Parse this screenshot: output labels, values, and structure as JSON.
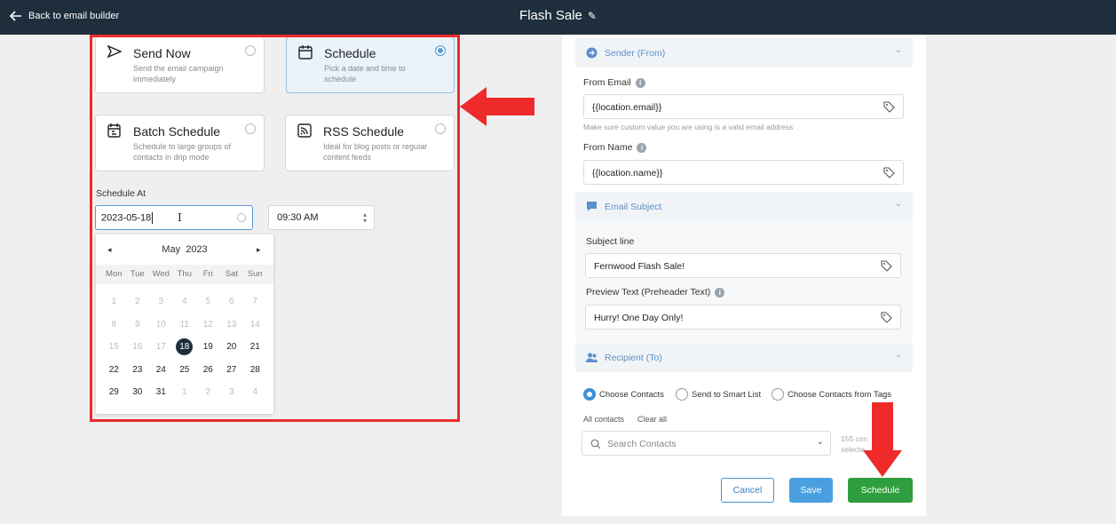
{
  "topbar": {
    "back_label": "Back to email builder",
    "title": "Flash Sale"
  },
  "options": [
    {
      "title": "Send Now",
      "desc": "Send the email campaign immediately"
    },
    {
      "title": "Schedule",
      "desc": "Pick a date and time to schedule"
    },
    {
      "title": "Batch Schedule",
      "desc": "Schedule to large groups of contacts in drip mode"
    },
    {
      "title": "RSS Schedule",
      "desc": "Ideal for blog posts or regular content feeds"
    }
  ],
  "schedule": {
    "label": "Schedule At",
    "date_value": "2023-05-18",
    "time_value": "09:30 AM",
    "calendar": {
      "month": "May",
      "year": "2023",
      "weekdays": [
        "Mon",
        "Tue",
        "Wed",
        "Thu",
        "Fri",
        "Sat",
        "Sun"
      ],
      "days": [
        [
          "1",
          "2",
          "3",
          "4",
          "5",
          "6",
          "7"
        ],
        [
          "8",
          "9",
          "10",
          "11",
          "12",
          "13",
          "14"
        ],
        [
          "15",
          "16",
          "17",
          "18",
          "19",
          "20",
          "21"
        ],
        [
          "22",
          "23",
          "24",
          "25",
          "26",
          "27",
          "28"
        ],
        [
          "29",
          "30",
          "31",
          "1",
          "2",
          "3",
          "4"
        ]
      ]
    }
  },
  "sender": {
    "title": "Sender (From)",
    "from_email_label": "From Email",
    "from_email_value": "{{location.email}}",
    "from_email_hint": "Make sure custom value you are using is a valid email address",
    "from_name_label": "From Name",
    "from_name_value": "{{location.name}}"
  },
  "subject": {
    "title": "Email Subject",
    "subject_label": "Subject line",
    "subject_value": "Fernwood Flash Sale!",
    "preview_label": "Preview Text (Preheader Text)",
    "preview_value": "Hurry! One Day Only!"
  },
  "recipient": {
    "title": "Recipient (To)",
    "options": [
      "Choose Contacts",
      "Send to Smart List",
      "Choose Contacts from Tags"
    ],
    "all_contacts": "All contacts",
    "clear_all": "Clear all",
    "search_placeholder": "Search Contacts",
    "count_line1": "155 con",
    "count_line2": "selecte"
  },
  "actions": {
    "cancel": "Cancel",
    "save": "Save",
    "schedule": "Schedule"
  },
  "colors": {
    "topbar": "#1e2e3d",
    "highlight_red": "#ee2a2a",
    "schedule_green": "#2f9e3f",
    "save_blue": "#4a9fe0"
  }
}
